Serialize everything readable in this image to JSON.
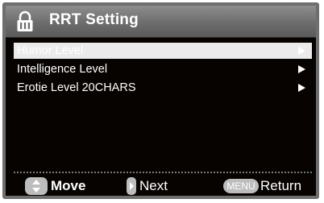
{
  "title_bar": {
    "icon": "lock-icon",
    "title": "RRT Setting"
  },
  "menu": {
    "selected_index": 0,
    "items": [
      {
        "label": "Humor Level",
        "arrow_icon": "right-arrow-icon"
      },
      {
        "label": "Intelligence Level",
        "arrow_icon": "right-arrow-icon"
      },
      {
        "label": "Erotie Level 20CHARS",
        "arrow_icon": "right-arrow-icon"
      }
    ]
  },
  "footer": {
    "move": {
      "icon": "up-down-icon",
      "label": "Move"
    },
    "next": {
      "icon": "right-key-icon",
      "label": "Next"
    },
    "return": {
      "key_label": "MENU",
      "label": "Return"
    }
  },
  "colors": {
    "background": "#070301",
    "frame": "#6e6e6e",
    "title_bar": "#7a7a7a",
    "selection": "#ebebeb",
    "key_icon": "#bdbdbd",
    "text": "#ffffff"
  }
}
